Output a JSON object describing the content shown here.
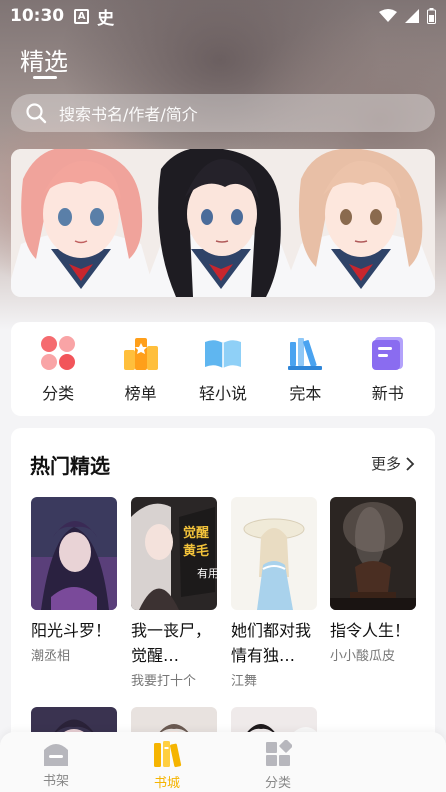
{
  "status_bar": {
    "time": "10:30",
    "left_icons": [
      "a-icon",
      "chinese-char-icon"
    ],
    "right_icons": [
      "wifi-icon",
      "signal-icon",
      "battery-icon"
    ]
  },
  "header": {
    "title": "精选"
  },
  "search": {
    "placeholder": "搜索书名/作者/简介"
  },
  "quick_nav": [
    {
      "label": "分类",
      "icon": "category-icon"
    },
    {
      "label": "榜单",
      "icon": "ranking-icon"
    },
    {
      "label": "轻小说",
      "icon": "light-novel-icon"
    },
    {
      "label": "完本",
      "icon": "completed-icon"
    },
    {
      "label": "新书",
      "icon": "new-book-icon"
    }
  ],
  "hot": {
    "title": "热门精选",
    "more": "更多",
    "books": [
      {
        "title": "阳光斗罗！",
        "author": "潮丞相"
      },
      {
        "title": "我一丧尸，觉醒…",
        "author": "我要打十个"
      },
      {
        "title": "她们都对我情有独…",
        "author": "江舞"
      },
      {
        "title": "指令人生！",
        "author": "小小酸瓜皮"
      }
    ]
  },
  "tabbar": {
    "tabs": [
      {
        "label": "书架"
      },
      {
        "label": "书城"
      },
      {
        "label": "分类"
      }
    ],
    "active": "书城"
  },
  "colors": {
    "accent": "#f5b400",
    "blue": "#4aa3f0",
    "purple": "#8a6cf0",
    "red": "#f2555a"
  }
}
